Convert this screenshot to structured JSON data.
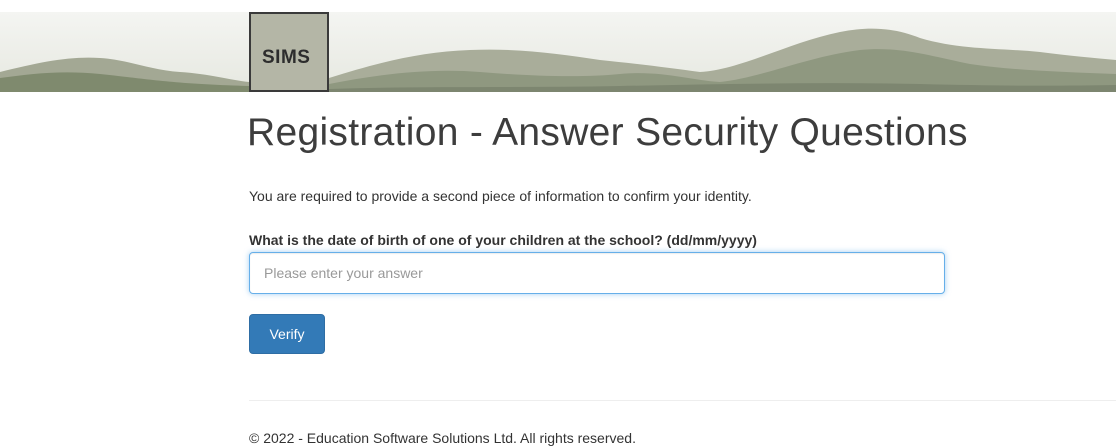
{
  "header": {
    "logo_text": "SIMS"
  },
  "main": {
    "title": "Registration - Answer Security Questions",
    "intro": "You are required to provide a second piece of information to confirm your identity.",
    "question_label": "What is the date of birth of one of your children at the school? (dd/mm/yyyy)",
    "answer_value": "",
    "answer_placeholder": "Please enter your answer",
    "verify_label": "Verify"
  },
  "footer": {
    "copyright": "© 2022 - Education Software Solutions Ltd. All rights reserved."
  },
  "colors": {
    "primary_button": "#337ab7",
    "input_focus_border": "#66afe9",
    "banner_mountain": "#8f9880",
    "banner_sky": "#eff0ec"
  }
}
